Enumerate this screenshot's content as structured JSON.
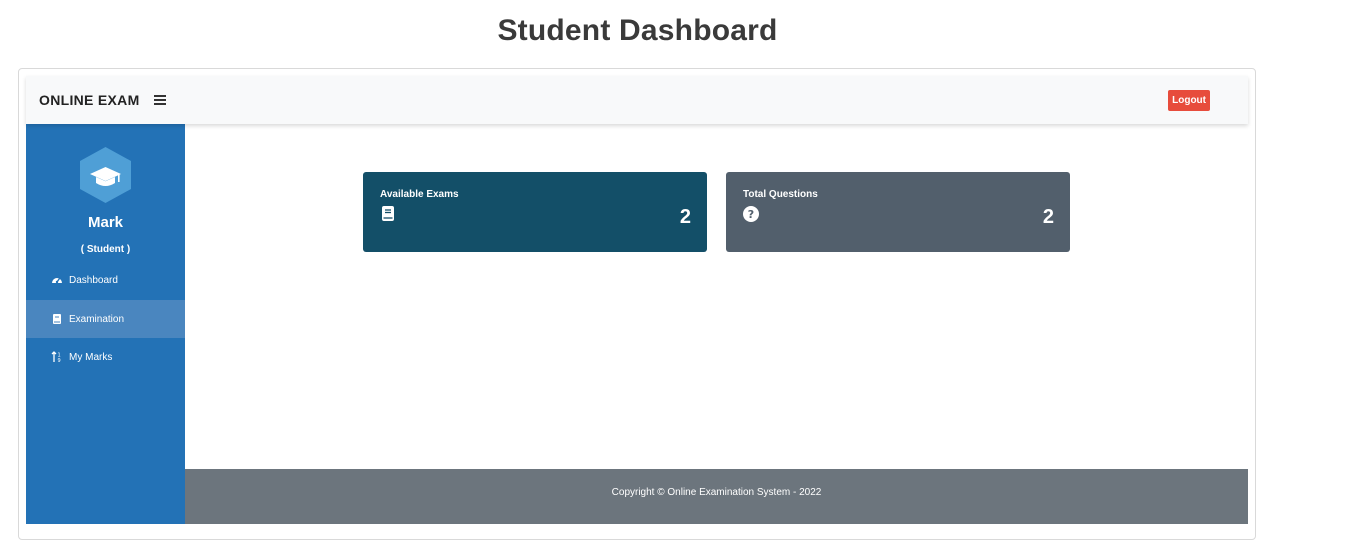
{
  "page": {
    "title": "Student Dashboard"
  },
  "navbar": {
    "brand": "ONLINE EXAM",
    "menu_icon": "hamburger-icon",
    "logout_label": "Logout",
    "logout_color": "#e74c3c"
  },
  "sidebar": {
    "user_name": "Mark",
    "user_role": "( Student )",
    "avatar_icon": "graduation-cap-icon",
    "bg_color": "#2372b6",
    "items": [
      {
        "label": "Dashboard",
        "icon": "tachometer-icon",
        "active": false
      },
      {
        "label": "Examination",
        "icon": "book-icon",
        "active": true
      },
      {
        "label": "My Marks",
        "icon": "sort-numeric-icon",
        "active": false
      }
    ]
  },
  "cards": [
    {
      "title": "Available Exams",
      "value": "2",
      "icon": "book-icon",
      "color": "#134f68"
    },
    {
      "title": "Total Questions",
      "value": "2",
      "icon": "question-circle-icon",
      "color": "#525f6c"
    }
  ],
  "footer": {
    "text": "Copyright © Online Examination System - 2022"
  }
}
